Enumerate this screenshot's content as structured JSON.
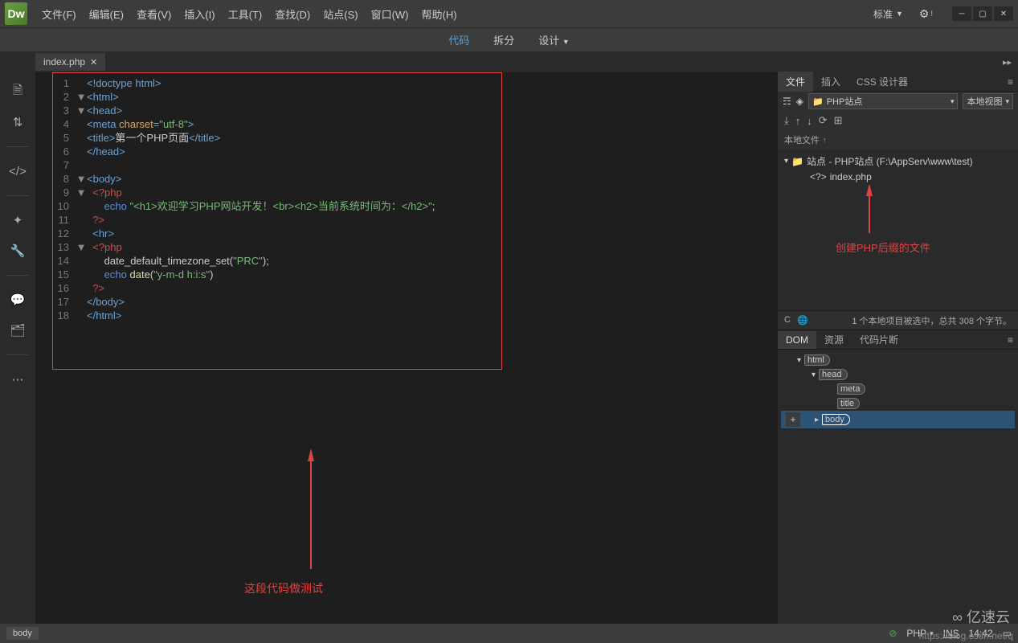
{
  "menubar": {
    "logo": "Dw",
    "items": [
      "文件(F)",
      "编辑(E)",
      "查看(V)",
      "插入(I)",
      "工具(T)",
      "查找(D)",
      "站点(S)",
      "窗口(W)",
      "帮助(H)"
    ],
    "layout_label": "标准"
  },
  "viewbar": {
    "code": "代码",
    "split": "拆分",
    "design": "设计"
  },
  "tab": {
    "name": "index.php"
  },
  "code": {
    "lines": [
      {
        "n": 1,
        "html": "<span class='c-tag'>&lt;!doctype html&gt;</span>"
      },
      {
        "n": 2,
        "fold": "▼",
        "html": "<span class='c-tag'>&lt;html&gt;</span>"
      },
      {
        "n": 3,
        "fold": "▼",
        "html": "<span class='c-tag'>&lt;head&gt;</span>"
      },
      {
        "n": 4,
        "html": "<span class='c-tag'>&lt;meta </span><span class='c-attr'>charset</span><span class='c-tag'>=</span><span class='c-str'>\"utf-8\"</span><span class='c-tag'>&gt;</span>"
      },
      {
        "n": 5,
        "html": "<span class='c-tag'>&lt;title&gt;</span><span class='c-txt'>第一个PHP页面</span><span class='c-tag'>&lt;/title&gt;</span>"
      },
      {
        "n": 6,
        "html": "<span class='c-tag'>&lt;/head&gt;</span>"
      },
      {
        "n": 7,
        "html": ""
      },
      {
        "n": 8,
        "fold": "▼",
        "html": "<span class='c-tag'>&lt;body&gt;</span>"
      },
      {
        "n": 9,
        "fold": "▼",
        "html": "  <span class='c-php'>&lt;?php</span>"
      },
      {
        "n": 10,
        "html": "      <span class='c-kw'>echo</span> <span class='c-str'>\"&lt;h1&gt;欢迎学习PHP网站开发！&lt;br&gt;&lt;h2&gt;当前系统时间为：&lt;/h2&gt;\"</span><span class='c-txt'>;</span>"
      },
      {
        "n": 11,
        "html": "  <span class='c-php'>?&gt;</span>"
      },
      {
        "n": 12,
        "html": "  <span class='c-tag'>&lt;hr&gt;</span>"
      },
      {
        "n": 13,
        "fold": "▼",
        "html": "  <span class='c-php'>&lt;?php</span>"
      },
      {
        "n": 14,
        "html": "      <span class='c-txt'>date_default_timezone_set(</span><span class='c-str'>\"PRC\"</span><span class='c-txt'>);</span>"
      },
      {
        "n": 15,
        "html": "      <span class='c-kw'>echo</span> <span class='c-fn'>date</span><span class='c-txt'>(</span><span class='c-str'>\"y-m-d h:i:s\"</span><span class='c-txt'>)</span>"
      },
      {
        "n": 16,
        "html": "  <span class='c-php'>?&gt;</span>"
      },
      {
        "n": 17,
        "html": "<span class='c-tag'>&lt;/body&gt;</span>"
      },
      {
        "n": 18,
        "html": "<span class='c-tag'>&lt;/html&gt;</span>"
      }
    ]
  },
  "annotations": {
    "code_test": "这段代码做测试",
    "create_php": "创建PHP后缀的文件"
  },
  "right": {
    "tabs": {
      "files": "文件",
      "insert": "插入",
      "css": "CSS 设计器"
    },
    "site_dropdown": "PHP站点",
    "view_dropdown": "本地视图",
    "local_files_hdr": "本地文件",
    "tree_root": "站点 - PHP站点 (F:\\AppServ\\www\\test)",
    "tree_file": "index.php",
    "status": "1 个本地项目被选中，总共 308 个字节。",
    "dom_tabs": {
      "dom": "DOM",
      "res": "资源",
      "snip": "代码片断"
    },
    "dom_nodes": [
      "html",
      "head",
      "meta",
      "title",
      "body"
    ]
  },
  "statusbar": {
    "crumb": "body",
    "lang": "PHP",
    "ins": "INS",
    "time": "14:42"
  },
  "watermark": "https://blog.csdn.net/q",
  "wm_brand": "∞ 亿速云"
}
